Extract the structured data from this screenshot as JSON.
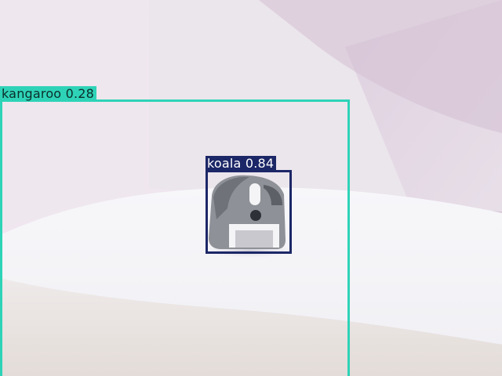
{
  "detections": [
    {
      "label": "kangaroo",
      "confidence": "0.28",
      "color": "#2ed3b7"
    },
    {
      "label": "koala",
      "confidence": "0.84",
      "color": "#1c2767"
    }
  ],
  "scene": {
    "background_gradient": [
      "#f0e2ef",
      "#d7cbd8"
    ],
    "floor_color": "#f6f5f8",
    "object_colors": {
      "body": "#8e9197",
      "dark": "#3c3f45",
      "white": "#f4f4f6"
    }
  }
}
